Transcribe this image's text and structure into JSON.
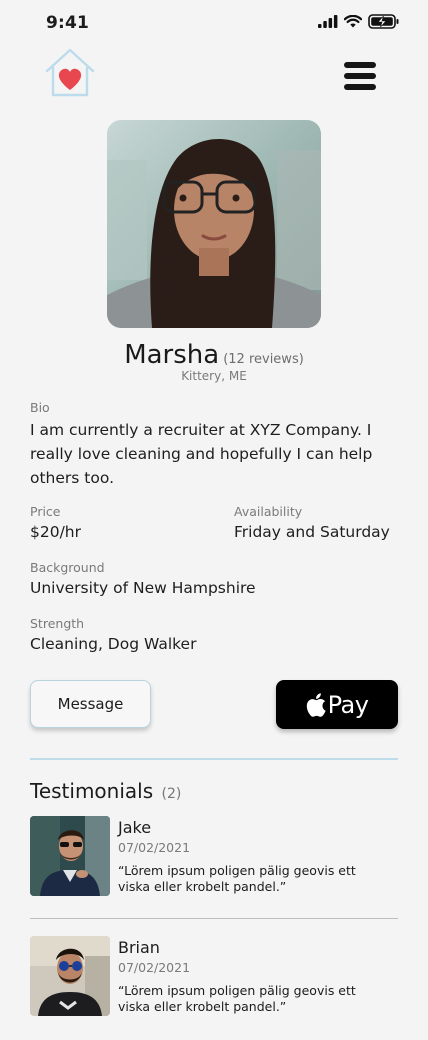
{
  "status_bar": {
    "time": "9:41"
  },
  "header": {
    "logo_icon": "house-heart-icon",
    "menu_icon": "hamburger-menu-icon"
  },
  "profile": {
    "name": "Marsha",
    "reviews": "(12 reviews)",
    "location": "Kittery, ME",
    "bio_label": "Bio",
    "bio": "I am currently a recruiter at XYZ Company. I really love cleaning and hopefully I can help others too.",
    "price_label": "Price",
    "price": "$20/hr",
    "availability_label": "Availability",
    "availability": "Friday and Saturday",
    "background_label": "Background",
    "background": "University of New Hampshire",
    "strength_label": "Strength",
    "strength": "Cleaning, Dog Walker"
  },
  "actions": {
    "message_label": "Message",
    "pay_label": "Pay",
    "pay_icon": "apple-logo-icon"
  },
  "testimonials": {
    "title": "Testimonials",
    "count": "(2)",
    "items": [
      {
        "name": "Jake",
        "date": "07/02/2021",
        "quote": "“Lörem ipsum poligen pälig geovis ett viska eller krobelt pandel.”"
      },
      {
        "name": "Brian",
        "date": "07/02/2021",
        "quote": "“Lörem ipsum poligen pälig geovis ett viska eller krobelt pandel.”"
      }
    ]
  },
  "colors": {
    "background": "#f4f4f4",
    "accent_blue": "#bfdcea",
    "heart_red": "#e8474f",
    "apple_pay_black": "#000000"
  }
}
